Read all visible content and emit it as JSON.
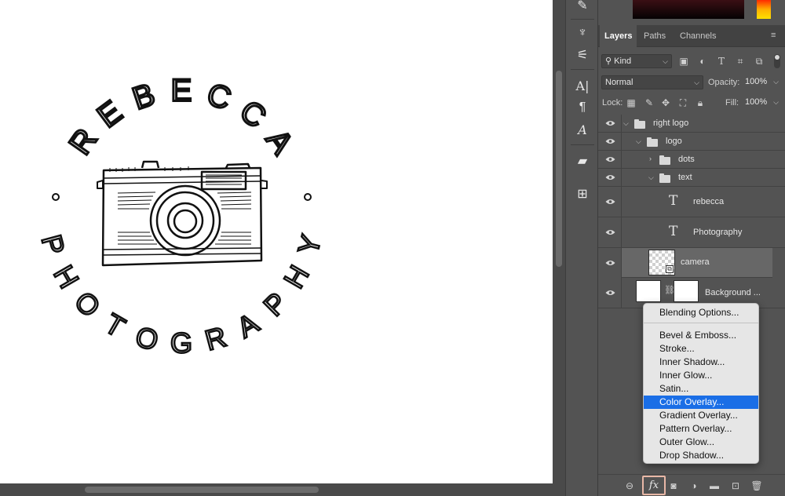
{
  "canvas": {
    "logo_name": "REBECCA",
    "logo_tagline": "PHOTOGRAPHY"
  },
  "panel_tabs": [
    "Layers",
    "Paths",
    "Channels"
  ],
  "filter": {
    "kind_label": "Kind",
    "blend_mode": "Normal",
    "opacity_label": "Opacity:",
    "opacity_value": "100%",
    "lock_label": "Lock:",
    "fill_label": "Fill:",
    "fill_value": "100%"
  },
  "layers": [
    {
      "name": "right logo",
      "type": "group",
      "expanded": true
    },
    {
      "name": "logo",
      "type": "group",
      "expanded": true
    },
    {
      "name": "dots",
      "type": "group",
      "expanded": false
    },
    {
      "name": "text",
      "type": "group",
      "expanded": true
    },
    {
      "name": "rebecca",
      "type": "text"
    },
    {
      "name": "Photography",
      "type": "text"
    },
    {
      "name": "camera",
      "type": "smart-object",
      "selected": true
    },
    {
      "name": "Background ...",
      "type": "pixel-with-mask"
    }
  ],
  "fx_menu": {
    "items": [
      "Blending Options...",
      "Bevel & Emboss...",
      "Stroke...",
      "Inner Shadow...",
      "Inner Glow...",
      "Satin...",
      "Color Overlay...",
      "Gradient Overlay...",
      "Pattern Overlay...",
      "Outer Glow...",
      "Drop Shadow..."
    ],
    "highlighted": "Color Overlay..."
  },
  "bottom_bar": {
    "fx_label": "fx",
    "icons": [
      "link-layers-icon",
      "fx-icon",
      "add-mask-icon",
      "adjustment-layer-icon",
      "new-group-icon",
      "new-layer-icon",
      "trash-icon"
    ]
  },
  "colors": {
    "panel_bg": "#535353",
    "selected_layer": "#676767",
    "menu_highlight": "#1a6ee6",
    "fx_button_border": "#e8b7a6"
  }
}
